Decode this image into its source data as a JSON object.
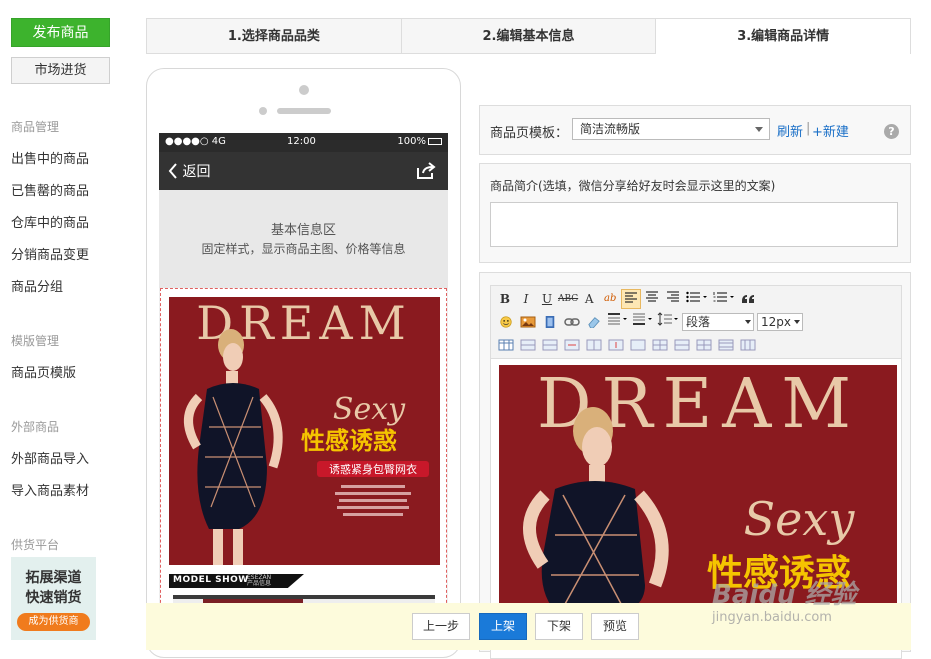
{
  "sidebar": {
    "publish_label": "发布商品",
    "market_label": "市场进货",
    "groups": [
      {
        "title": "商品管理",
        "items": [
          "出售中的商品",
          "已售罄的商品",
          "仓库中的商品",
          "分销商品变更",
          "商品分组"
        ]
      },
      {
        "title": "模版管理",
        "items": [
          "商品页模版"
        ]
      },
      {
        "title": "外部商品",
        "items": [
          "外部商品导入",
          "导入商品素材"
        ]
      },
      {
        "title": "供货平台",
        "items": []
      }
    ],
    "promo": {
      "line1": "拓展渠道",
      "line2": "快速销货",
      "button": "成为供货商"
    }
  },
  "steps": [
    "1.选择商品品类",
    "2.编辑基本信息",
    "3.编辑商品详情"
  ],
  "active_step": 2,
  "phone": {
    "signal": "●●●●○ 4G",
    "time": "12:00",
    "battery": "100%",
    "back_label": "返回",
    "info_title": "基本信息区",
    "info_subtitle": "固定样式，显示商品主图、价格等信息",
    "model_show": "MODEL SHOW",
    "model_show_brand": "ESEZAN",
    "model_show_sub": "产品信息"
  },
  "poster": {
    "headline": "DREAM",
    "script": "Sexy",
    "cn_title": "性感诱惑",
    "cn_tag": "诱惑紧身包臀网衣",
    "colors": {
      "bg": "#8a1a1f",
      "headline": "#e8c9a8",
      "accent": "#f5c400"
    }
  },
  "template_panel": {
    "label": "商品页模板：",
    "selected": "简洁流畅版",
    "refresh": "刷新",
    "separator": "|",
    "new": "+新建",
    "help": "?"
  },
  "intro_panel": {
    "label": "商品简介(选填，微信分享给好友时会显示这里的文案)",
    "value": ""
  },
  "editor": {
    "toolbar": {
      "bold": "B",
      "italic": "I",
      "underline": "U",
      "strike": "ABC",
      "fontcolor": "A",
      "bgcolor": "ab",
      "paragraph": "段落",
      "fontsize": "12px"
    }
  },
  "actions": {
    "prev": "上一步",
    "shelf": "上架",
    "off": "下架",
    "preview": "预览"
  },
  "watermark": {
    "main": "Baidu 经验",
    "sub": "jingyan.baidu.com"
  },
  "colors": {
    "green": "#3db32d",
    "blue": "#1a7ad9",
    "link": "#1a6fc7",
    "action_bg": "#fdfbdc"
  }
}
